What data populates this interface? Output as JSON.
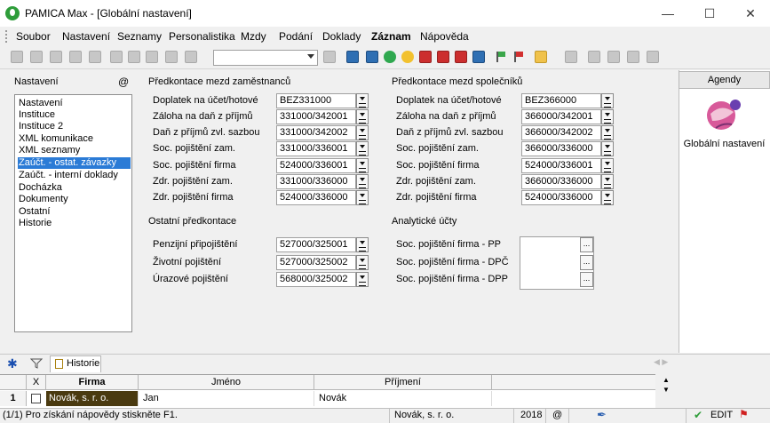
{
  "window": {
    "title": "PAMICA Max - [Globální nastavení]"
  },
  "menu": [
    "Soubor",
    "Nastavení",
    "Seznamy",
    "Personalistika",
    "Mzdy",
    "Podání",
    "Doklady",
    "Záznam",
    "Nápověda"
  ],
  "nav": {
    "title": "Nastavení",
    "items": [
      "Nastavení",
      "Instituce",
      "Instituce 2",
      "XML komunikace",
      "XML seznamy",
      "Zaúčt. - ostat. závazky",
      "Zaúčt. - interní doklady",
      "Docházka",
      "Dokumenty",
      "Ostatní",
      "Historie"
    ],
    "selected_index": 5
  },
  "employees": {
    "title": "Předkontace mezd zaměstnanců",
    "rows": [
      {
        "label": "Doplatek na účet/hotové",
        "value": "BEZ331000"
      },
      {
        "label": "Záloha na daň z příjmů",
        "value": "331000/342001"
      },
      {
        "label": "Daň z příjmů zvl. sazbou",
        "value": "331000/342002"
      },
      {
        "label": "Soc. pojištění zam.",
        "value": "331000/336001"
      },
      {
        "label": "Soc. pojištění firma",
        "value": "524000/336001"
      },
      {
        "label": "Zdr. pojištění zam.",
        "value": "331000/336000"
      },
      {
        "label": "Zdr. pojištění firma",
        "value": "524000/336000"
      }
    ]
  },
  "partners": {
    "title": "Předkontace mezd společníků",
    "rows": [
      {
        "label": "Doplatek na účet/hotové",
        "value": "BEZ366000"
      },
      {
        "label": "Záloha na daň z příjmů",
        "value": "366000/342001"
      },
      {
        "label": "Daň z příjmů zvl. sazbou",
        "value": "366000/342002"
      },
      {
        "label": "Soc. pojištění zam.",
        "value": "366000/336000"
      },
      {
        "label": "Soc. pojištění firma",
        "value": "524000/336001"
      },
      {
        "label": "Zdr. pojištění zam.",
        "value": "366000/336000"
      },
      {
        "label": "Zdr. pojištění firma",
        "value": "524000/336000"
      }
    ]
  },
  "other": {
    "title": "Ostatní předkontace",
    "rows": [
      {
        "label": "Penzijní připojištění",
        "value": "527000/325001"
      },
      {
        "label": "Životní pojištění",
        "value": "527000/325002"
      },
      {
        "label": "Úrazové pojištění",
        "value": "568000/325002"
      }
    ]
  },
  "analytic": {
    "title": "Analytické účty",
    "rows": [
      {
        "label": "Soc. pojištění firma - PP"
      },
      {
        "label": "Soc. pojištění firma - DPČ"
      },
      {
        "label": "Soc. pojištění firma - DPP"
      }
    ]
  },
  "agendy": {
    "header": "Agendy",
    "item_label": "Globální nastavení"
  },
  "bottom_tabs": {
    "historie": "Historie"
  },
  "grid": {
    "headers": [
      "X",
      "Firma",
      "Jméno",
      "Příjmení"
    ],
    "row": {
      "num": "1",
      "firma": "Novák, s. r. o.",
      "jmeno": "Jan",
      "prijmeni": "Novák"
    }
  },
  "status": {
    "message": "(1/1) Pro získání nápovědy stiskněte F1.",
    "company": "Novák, s. r. o.",
    "year": "2018",
    "at_symbol": "@",
    "mode": "EDIT"
  },
  "icons": {
    "app": "pamica-logo-icon",
    "agenda": "globe-settings-icon"
  },
  "colors": {
    "selection": "#2b7bd6",
    "firma_cell": "#4a3a10"
  }
}
